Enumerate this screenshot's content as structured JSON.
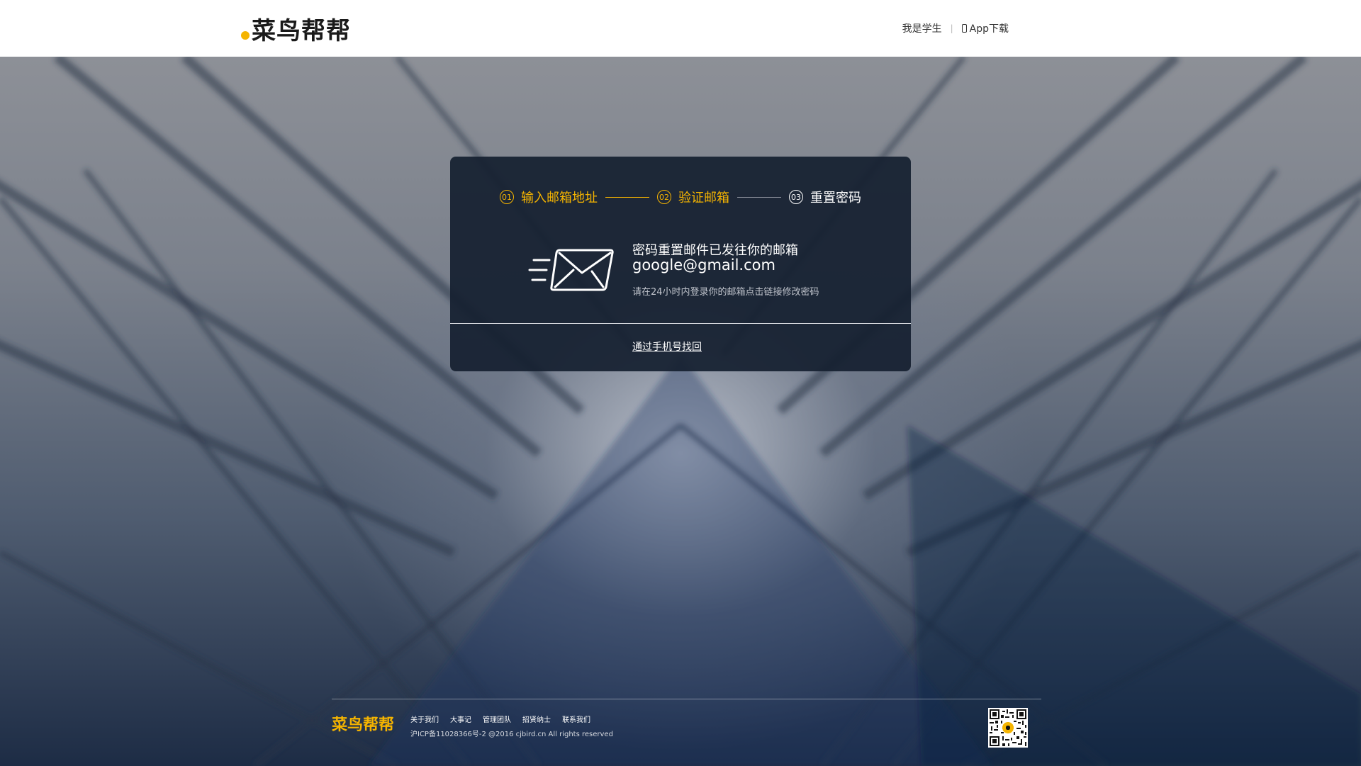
{
  "header": {
    "logo_text": "菜鸟帮帮",
    "nav_student": "我是学生",
    "nav_separator": "|",
    "nav_app": "App下载"
  },
  "steps": [
    {
      "num": "01",
      "label": "输入邮箱地址",
      "state": "done"
    },
    {
      "num": "02",
      "label": "验证邮箱",
      "state": "done"
    },
    {
      "num": "03",
      "label": "重置密码",
      "state": "current"
    }
  ],
  "message": {
    "title": "密码重置邮件已发往你的邮箱",
    "email": "google@gmail.com",
    "hint": "请在24小时内登录你的邮箱点击链接修改密码",
    "phone_link": "通过手机号找回"
  },
  "footer": {
    "logo_text": "菜鸟帮帮",
    "links": [
      "关于我们",
      "大事记",
      "管理团队",
      "招贤纳士",
      "联系我们"
    ],
    "copyright": "沪ICP备11028366号-2 @2016 cjbird.cn All rights reserved"
  },
  "icons": {
    "phone": "phone-icon",
    "mail": "mail-icon",
    "qr": "qr-code-icon"
  },
  "colors": {
    "accent": "#f5b400",
    "card_bg": "#162030",
    "header_bg": "#ffffff"
  }
}
